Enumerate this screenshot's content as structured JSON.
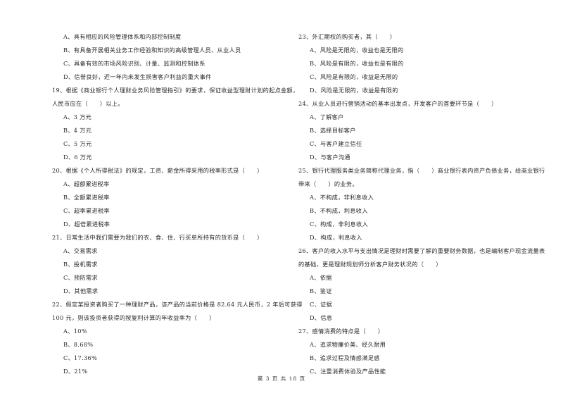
{
  "page": {
    "left_column": [
      {
        "type": "option",
        "text": "A、具有相应的风险管理体系和内部控制制度"
      },
      {
        "type": "option",
        "text": "B、有具备开展相关业务工作经验和知识的高级管理人员、从业人员"
      },
      {
        "type": "option",
        "text": "C、具备有效的市场风险识别、计量、监测和控制体系"
      },
      {
        "type": "option",
        "text": "D、信誉良好，近一年内未发生损害客户利益的重大事件"
      },
      {
        "type": "question",
        "text": "19、根据《商业银行个人理财业务风险管理指引》的要求，保证收益型理财计划的起点金额，"
      },
      {
        "type": "question",
        "text": "人民币应在（　　）以上。"
      },
      {
        "type": "option",
        "text": "A、3 万元"
      },
      {
        "type": "option",
        "text": "B、4 万元"
      },
      {
        "type": "option",
        "text": "C、5 万元"
      },
      {
        "type": "option",
        "text": "D、6 万元"
      },
      {
        "type": "question",
        "text": "20、根据《个人所得税法》的规定，工资、薪金所得采用的税率形式是（　　）"
      },
      {
        "type": "option",
        "text": "A、超额累进税率"
      },
      {
        "type": "option",
        "text": "B、全额累进税率"
      },
      {
        "type": "option",
        "text": "C、超率累进税率"
      },
      {
        "type": "option",
        "text": "D、超倍累进税率"
      },
      {
        "type": "question",
        "text": "21、日常生活中我们需要为我们的衣、食、住、行买单所持有的货币是（　　）"
      },
      {
        "type": "option",
        "text": "A、交易需求"
      },
      {
        "type": "option",
        "text": "B、投机需求"
      },
      {
        "type": "option",
        "text": "C、预防需求"
      },
      {
        "type": "option",
        "text": "D、其他需求"
      },
      {
        "type": "question",
        "text": "22、假定某投资者购买了一种理财产品，该产品的当前价格是 82.64 元人民币，2 年后可获得"
      },
      {
        "type": "question",
        "text": "100 元，则该投资者获得的按复利计算的年收益率为（　　）"
      },
      {
        "type": "option",
        "text": "A、10%"
      },
      {
        "type": "option",
        "text": "B、8.68%"
      },
      {
        "type": "option",
        "text": "C、17.36%"
      },
      {
        "type": "option",
        "text": "D、21%"
      }
    ],
    "right_column": [
      {
        "type": "question",
        "text": "23、外汇期权的购买者，其（　　）"
      },
      {
        "type": "option",
        "text": "A、风险是无限的，收益也是无限的"
      },
      {
        "type": "option",
        "text": "B、风险是有限的，收益也是有限的"
      },
      {
        "type": "option",
        "text": "C、风险是有限的，收益是无限的"
      },
      {
        "type": "option",
        "text": "D、风险是无限的，收益是有限的"
      },
      {
        "type": "question",
        "text": "24、从业人员进行营销活动的基本出发点，开发客户的首要环节是（　　）"
      },
      {
        "type": "option",
        "text": "A、了解客户"
      },
      {
        "type": "option",
        "text": "B、选择目标客户"
      },
      {
        "type": "option",
        "text": "C、与客户建立信任"
      },
      {
        "type": "option",
        "text": "D、与客户沟通"
      },
      {
        "type": "question",
        "text": "25、银行代理服务类业务简称代理业务，指（　　）商业银行表内资产负债业务，给商业银行"
      },
      {
        "type": "question",
        "text": "带来（　　）的业务。"
      },
      {
        "type": "option",
        "text": "A、不构成，非利息收入"
      },
      {
        "type": "option",
        "text": "B、不构成，利息收入"
      },
      {
        "type": "option",
        "text": "C、构成，非利息收入"
      },
      {
        "type": "option",
        "text": "D、构成，利息收入"
      },
      {
        "type": "question",
        "text": "26、客户的收入水平与支出情况是理财时需要了解的重要财务数据，也是编制客户现金流量表"
      },
      {
        "type": "question",
        "text": "的基础，更是理财规划师分析客户财务状况的（　　）"
      },
      {
        "type": "option",
        "text": "A、依据"
      },
      {
        "type": "option",
        "text": "B、鉴证"
      },
      {
        "type": "option",
        "text": "C、证据"
      },
      {
        "type": "option",
        "text": "D、信息"
      },
      {
        "type": "question",
        "text": "27、感情消费的特点是（　　）"
      },
      {
        "type": "option",
        "text": "A、追求物廉价美、经久耐用"
      },
      {
        "type": "option",
        "text": "B、追求过程及情感满足感"
      },
      {
        "type": "option",
        "text": "C、注重消费体验及产品性能"
      }
    ],
    "footer": "第 3 页 共 18 页"
  }
}
